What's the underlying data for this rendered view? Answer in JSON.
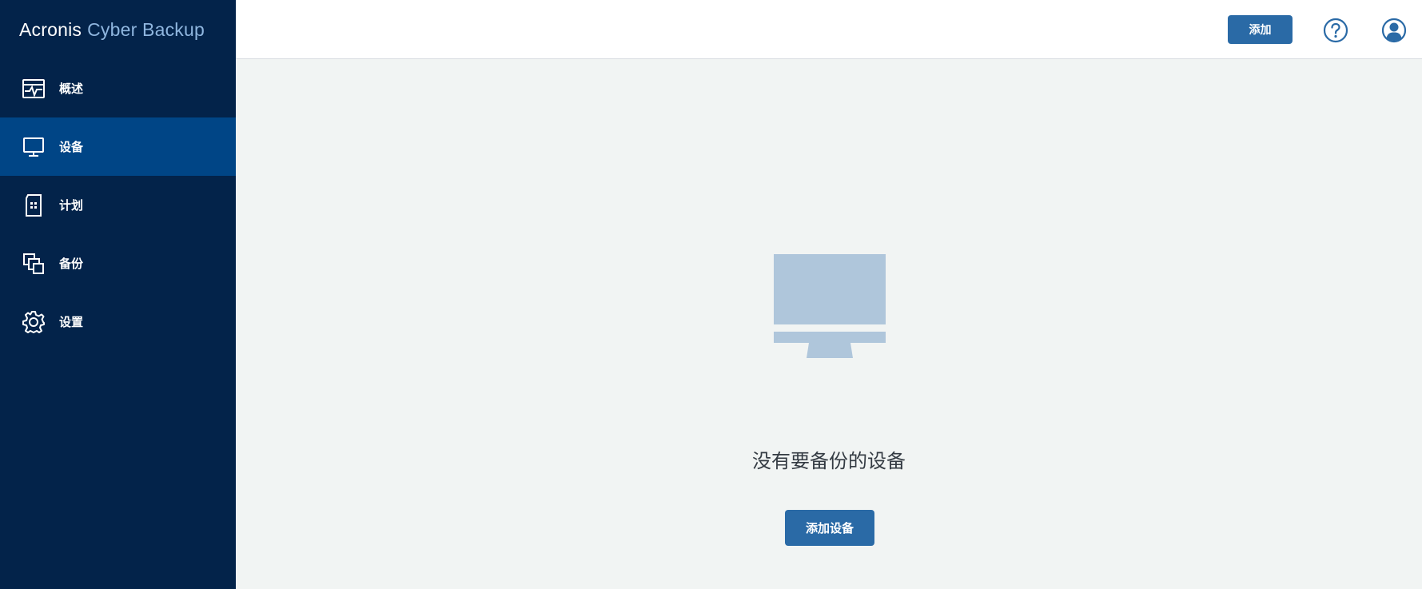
{
  "app": {
    "brand_primary": "Acronis",
    "brand_secondary": "Cyber Backup"
  },
  "sidebar": {
    "items": [
      {
        "label": "概述",
        "icon": "overview-pulse-icon",
        "active": false
      },
      {
        "label": "设备",
        "icon": "monitor-icon",
        "active": true
      },
      {
        "label": "计划",
        "icon": "plan-icon",
        "active": false
      },
      {
        "label": "备份",
        "icon": "backup-copies-icon",
        "active": false
      },
      {
        "label": "设置",
        "icon": "gear-icon",
        "active": false
      }
    ]
  },
  "header": {
    "add_label": "添加",
    "help_icon": "help-icon",
    "user_icon": "user-icon"
  },
  "main": {
    "empty_icon": "monitor-icon",
    "empty_message": "没有要备份的设备",
    "add_device_label": "添加设备"
  },
  "colors": {
    "sidebar_bg": "#03234a",
    "sidebar_active": "#004586",
    "primary_button": "#2a6aa6",
    "brand_secondary": "#8fb6df",
    "empty_icon": "#afc6db",
    "icon_blue": "#2a6aa6",
    "content_bg": "#f1f4f3"
  }
}
